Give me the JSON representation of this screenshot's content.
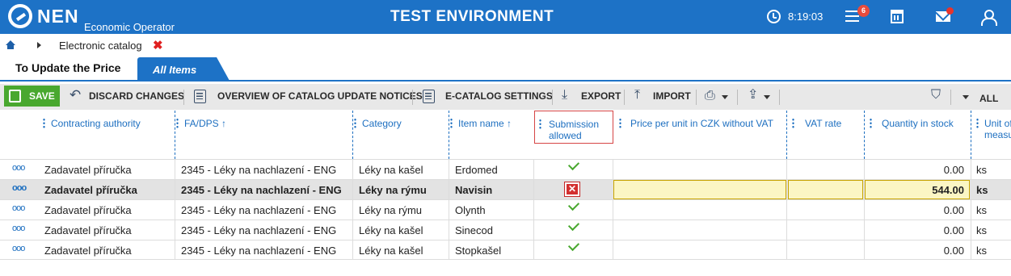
{
  "app": {
    "brand": "NEN",
    "subtitle": "Economic Operator",
    "environment": "TEST ENVIRONMENT",
    "time": "8:19:03",
    "notifications_count": "6",
    "colors": {
      "header": "#1d72c6",
      "save": "#49a82f",
      "accent_text": "#1d6fc0",
      "alert": "#e02020"
    }
  },
  "breadcrumb": {
    "label": "Electronic catalog",
    "close": "✖"
  },
  "tabs": [
    {
      "label": "To Update the Price",
      "active": true
    },
    {
      "label": "All Items",
      "active": false
    }
  ],
  "toolbar": {
    "save": "SAVE",
    "discard": "DISCARD CHANGES",
    "overview": "OVERVIEW OF CATALOG UPDATE NOTICES",
    "settings": "E-CATALOG SETTINGS",
    "export": "EXPORT",
    "import": "IMPORT",
    "filter_all": "ALL"
  },
  "table": {
    "headers": {
      "authority": "Contracting authority",
      "fadps": "FA/DPS ↑",
      "category": "Category",
      "item": "Item name ↑",
      "submission1": "Submission",
      "submission2": "allowed",
      "price": "Price per unit in CZK without VAT",
      "vat": "VAT rate",
      "qty": "Quantity in stock",
      "unit1": "Unit of",
      "unit2": "measu"
    },
    "rows": [
      {
        "authority": "Zadavatel příručka",
        "fadps": "2345 - Léky na nachlazení - ENG",
        "category": "Léky na kašel",
        "item": "Erdomed",
        "submission": "allowed",
        "price": "",
        "vat": "",
        "qty": "0.00",
        "unit": "ks"
      },
      {
        "authority": "Zadavatel příručka",
        "fadps": "2345 - Léky na nachlazení - ENG",
        "category": "Léky na rýmu",
        "item": "Navisin",
        "submission": "not-allowed",
        "price": "",
        "vat": "",
        "qty": "544.00",
        "unit": "ks"
      },
      {
        "authority": "Zadavatel příručka",
        "fadps": "2345 - Léky na nachlazení - ENG",
        "category": "Léky na rýmu",
        "item": "Olynth",
        "submission": "allowed",
        "price": "",
        "vat": "",
        "qty": "0.00",
        "unit": "ks"
      },
      {
        "authority": "Zadavatel příručka",
        "fadps": "2345 - Léky na nachlazení - ENG",
        "category": "Léky na kašel",
        "item": "Sinecod",
        "submission": "allowed",
        "price": "",
        "vat": "",
        "qty": "0.00",
        "unit": "ks"
      },
      {
        "authority": "Zadavatel příručka",
        "fadps": "2345 - Léky na nachlazení - ENG",
        "category": "Léky na kašel",
        "item": "Stopkašel",
        "submission": "allowed",
        "price": "",
        "vat": "",
        "qty": "0.00",
        "unit": "ks"
      }
    ]
  }
}
